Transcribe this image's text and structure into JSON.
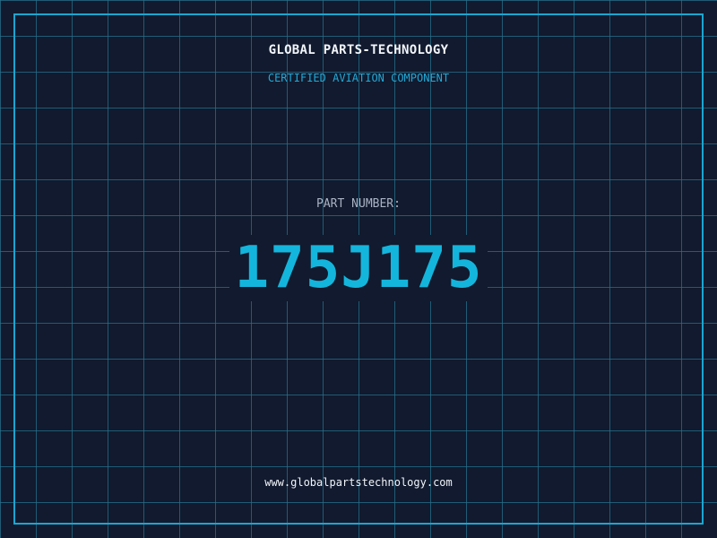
{
  "header": {
    "company_name": "GLOBAL PARTS-TECHNOLOGY",
    "tagline": "CERTIFIED AVIATION COMPONENT"
  },
  "part": {
    "label": "PART NUMBER:",
    "number": "175J175"
  },
  "footer": {
    "website": "www.globalpartstechnology.com"
  },
  "colors": {
    "background": "#111a2e",
    "grid": "#26708c",
    "accent": "#14b5dc",
    "text": "#f2f5fa",
    "muted": "#a9b3c4"
  }
}
